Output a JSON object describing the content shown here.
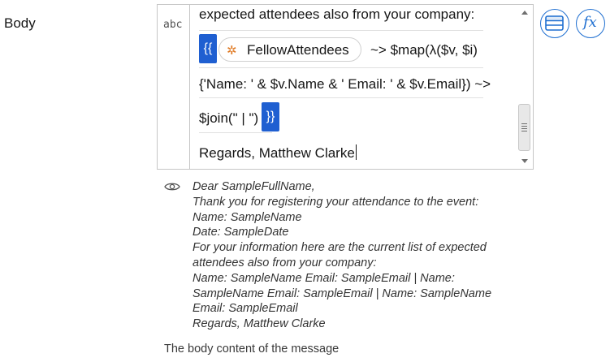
{
  "field": {
    "label": "Body",
    "helper_text": "The body content of the message",
    "type_badge": "abc"
  },
  "editor": {
    "line1": "expected attendees also from your company:",
    "open_brace": "{{",
    "chip_label": "FellowAttendees",
    "chip_icon": "flow-variable-icon",
    "line2_after_chip": "~> $map(λ($v, $i)",
    "line3": "{'Name: ' & $v.Name & ' Email: ' & $v.Email}) ~>",
    "line4": "$join(\" | \")",
    "close_brace": "}}",
    "line5": "Regards, Matthew Clarke"
  },
  "buttons": {
    "list_icon": "list-icon",
    "fx_label": "fx"
  },
  "preview": {
    "icon": "eye-icon",
    "lines": [
      "Dear SampleFullName,",
      "Thank you for registering your attendance to the event:",
      "Name: SampleName",
      "Date: SampleDate",
      "For your information here are the current list of expected",
      "attendees also from your company:",
      "Name: SampleName Email: SampleEmail | Name:",
      "SampleName Email: SampleEmail | Name: SampleName",
      "Email: SampleEmail",
      "Regards, Matthew Clarke"
    ]
  },
  "colors": {
    "accent": "#1f5fd1",
    "chip_icon": "#e07b26"
  }
}
